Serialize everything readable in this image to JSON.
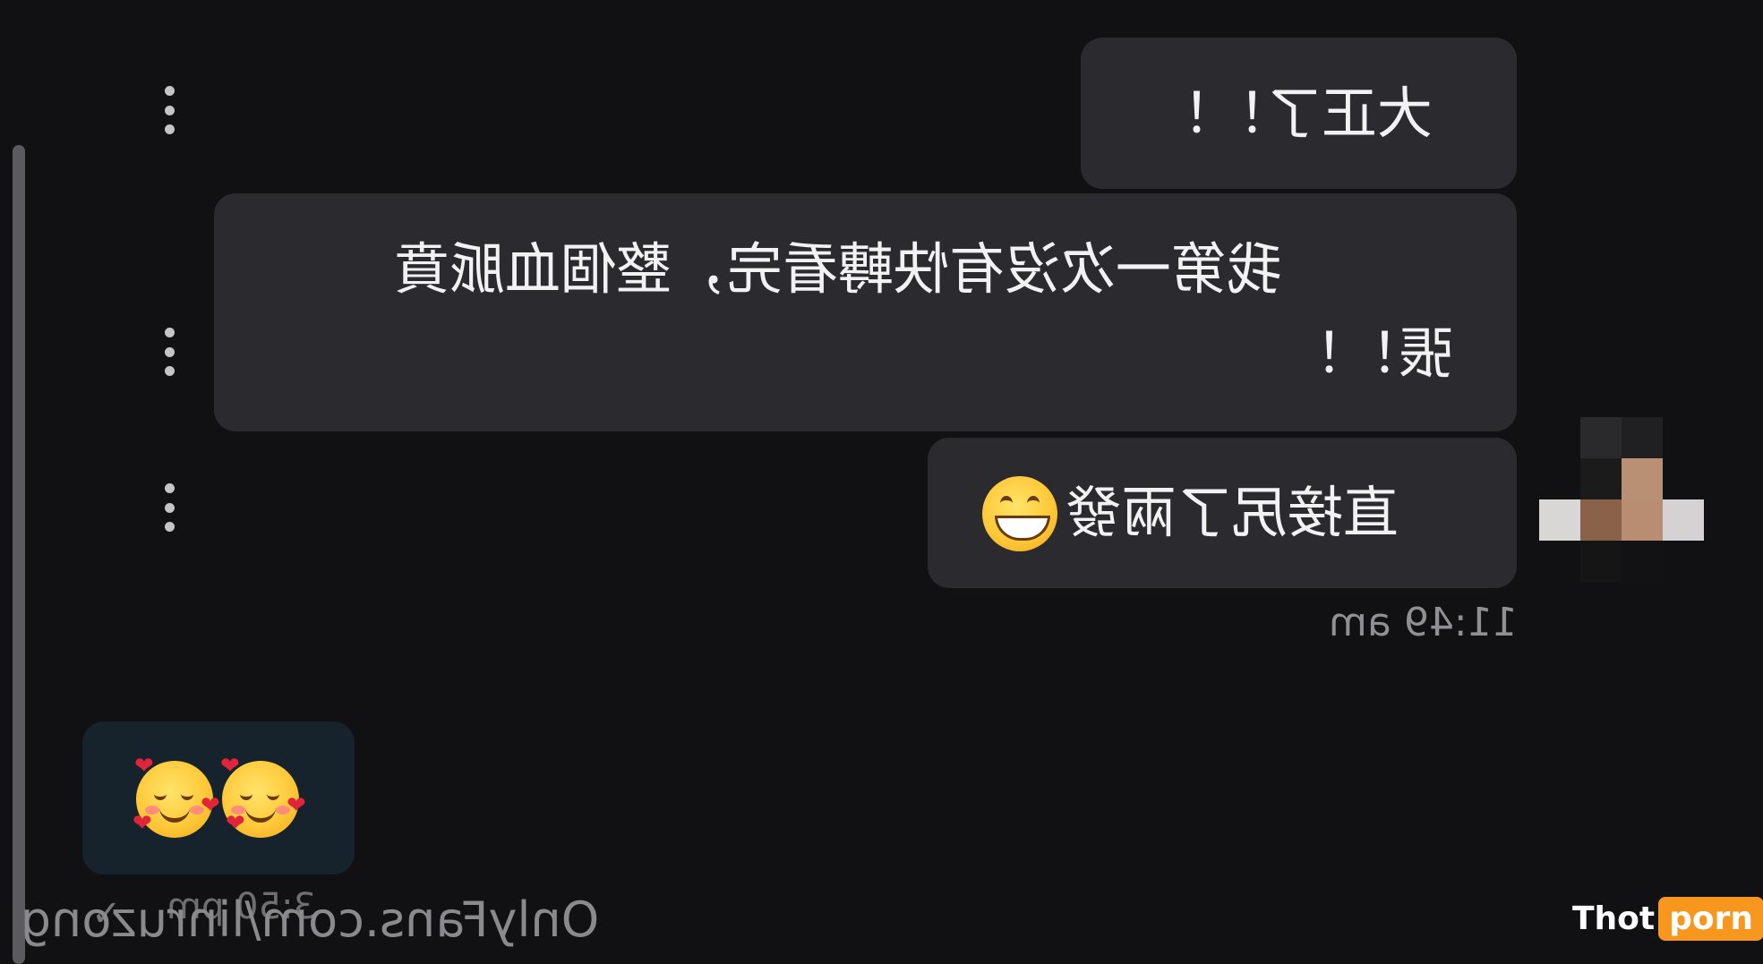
{
  "chat": {
    "messages": [
      {
        "id": "msg-1",
        "text": "大正了！！",
        "mirrored": true
      },
      {
        "id": "msg-2",
        "line1": "我第一次沒有快轉看完，整個血脈賁",
        "line2": "張！！",
        "mirrored": true
      },
      {
        "id": "msg-3",
        "text": "直接尻了兩發",
        "emoji": "grinning-face",
        "mirrored": true
      }
    ],
    "incoming_timestamp": "11:49 am",
    "reply": {
      "emojis": [
        "smiling-face-with-hearts",
        "smiling-face-with-hearts"
      ],
      "timestamp": "3:50 pm",
      "status_icon": "check-icon"
    }
  },
  "watermark": "OnlyFans.com/linruzong",
  "logo": {
    "part1": "Thot",
    "part2": "porn",
    "accent_color": "#f7971e"
  },
  "icons": {
    "message_menu": "more-vertical-icon",
    "scrollbar": "scrollbar",
    "avatar": "pixelated-avatar"
  },
  "colors": {
    "background": "#111113",
    "incoming_bubble": "#2b2b2f",
    "outgoing_bubble": "#16232c",
    "text": "#f2f2f4",
    "muted": "#8f8f94"
  }
}
